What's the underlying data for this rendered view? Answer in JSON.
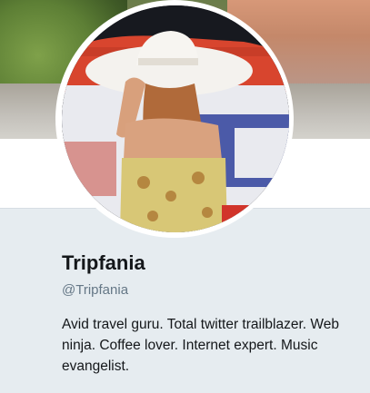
{
  "profile": {
    "name": "Tripfania",
    "handle": "@Tripfania",
    "bio": "Avid travel guru. Total twitter trailblazer. Web ninja. Coffee lover. Internet expert. Music evangelist."
  },
  "colors": {
    "background": "#e6ecf0",
    "card": "#ffffff",
    "name_text": "#14171a",
    "handle_text": "#657786"
  },
  "images": {
    "banner": "banner-photo",
    "avatar": "avatar-photo"
  }
}
